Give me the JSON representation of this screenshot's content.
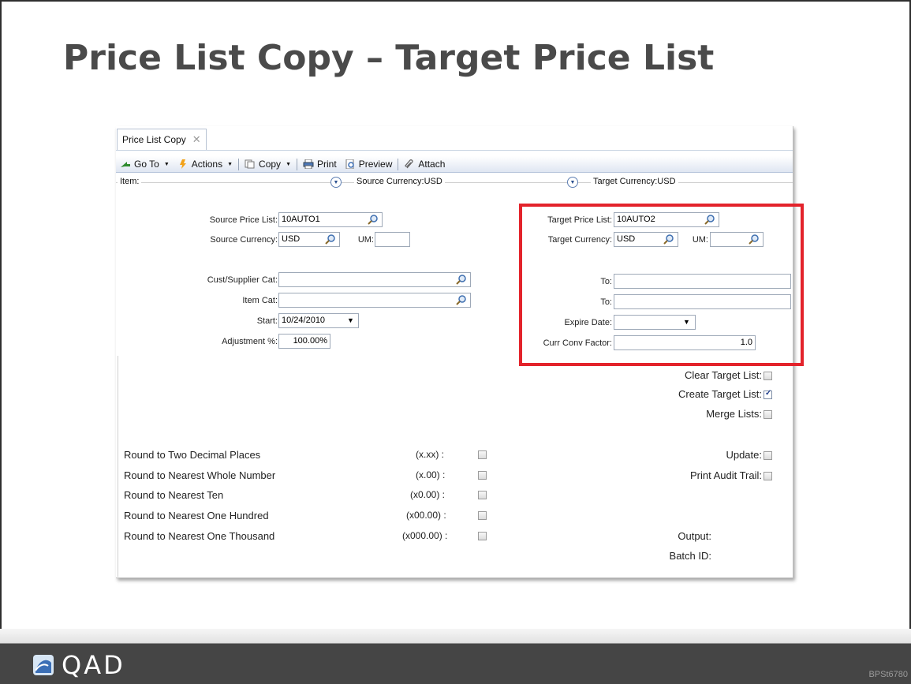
{
  "slide": {
    "title": "Price List Copy – Target Price List",
    "logo_text": "QAD",
    "slide_code": "BPSt6780"
  },
  "window": {
    "tab_label": "Price List Copy",
    "tab_close_icon": "close-icon"
  },
  "toolbar": {
    "goto_label": "Go To",
    "actions_label": "Actions",
    "copy_label": "Copy",
    "print_label": "Print",
    "preview_label": "Preview",
    "attach_label": "Attach"
  },
  "filterbar": {
    "item_label": "Item:",
    "source_currency_label": "Source Currency:USD",
    "target_currency_label": "Target Currency:USD"
  },
  "source": {
    "price_list_label": "Source Price List:",
    "price_list_value": "10AUTO1",
    "currency_label": "Source Currency:",
    "currency_value": "USD",
    "um_label": "UM:",
    "um_value": "",
    "cust_supplier_cat_label": "Cust/Supplier Cat:",
    "cust_supplier_cat_value": "",
    "item_cat_label": "Item Cat:",
    "item_cat_value": "",
    "start_label": "Start:",
    "start_value": "10/24/2010",
    "adjustment_label": "Adjustment %:",
    "adjustment_value": "100.00%"
  },
  "target": {
    "price_list_label": "Target Price List:",
    "price_list_value": "10AUTO2",
    "currency_label": "Target Currency:",
    "currency_value": "USD",
    "um_label": "UM:",
    "um_value": "",
    "to1_label": "To:",
    "to1_value": "",
    "to2_label": "To:",
    "to2_value": "",
    "expire_label": "Expire Date:",
    "expire_value": "",
    "curr_conv_label": "Curr Conv Factor:",
    "curr_conv_value": "1.0"
  },
  "options": {
    "clear_target_label": "Clear Target List:",
    "clear_target_checked": false,
    "create_target_label": "Create Target List:",
    "create_target_checked": true,
    "merge_lists_label": "Merge Lists:",
    "merge_lists_checked": false,
    "update_label": "Update:",
    "update_checked": false,
    "print_audit_label": "Print Audit Trail:",
    "print_audit_checked": false,
    "output_label": "Output:",
    "batch_id_label": "Batch ID:"
  },
  "rounding": [
    {
      "label": "Round to Two Decimal Places",
      "format": "(x.xx) :",
      "checked": false
    },
    {
      "label": "Round to Nearest Whole Number",
      "format": "(x.00) :",
      "checked": false
    },
    {
      "label": "Round to Nearest Ten",
      "format": "(x0.00) :",
      "checked": false
    },
    {
      "label": "Round to Nearest One Hundred",
      "format": "(x00.00) :",
      "checked": false
    },
    {
      "label": "Round to Nearest One Thousand",
      "format": "(x000.00) :",
      "checked": false
    }
  ],
  "colors": {
    "highlight": "#e3232b",
    "title": "#4a4a4a",
    "footer": "#454545"
  }
}
